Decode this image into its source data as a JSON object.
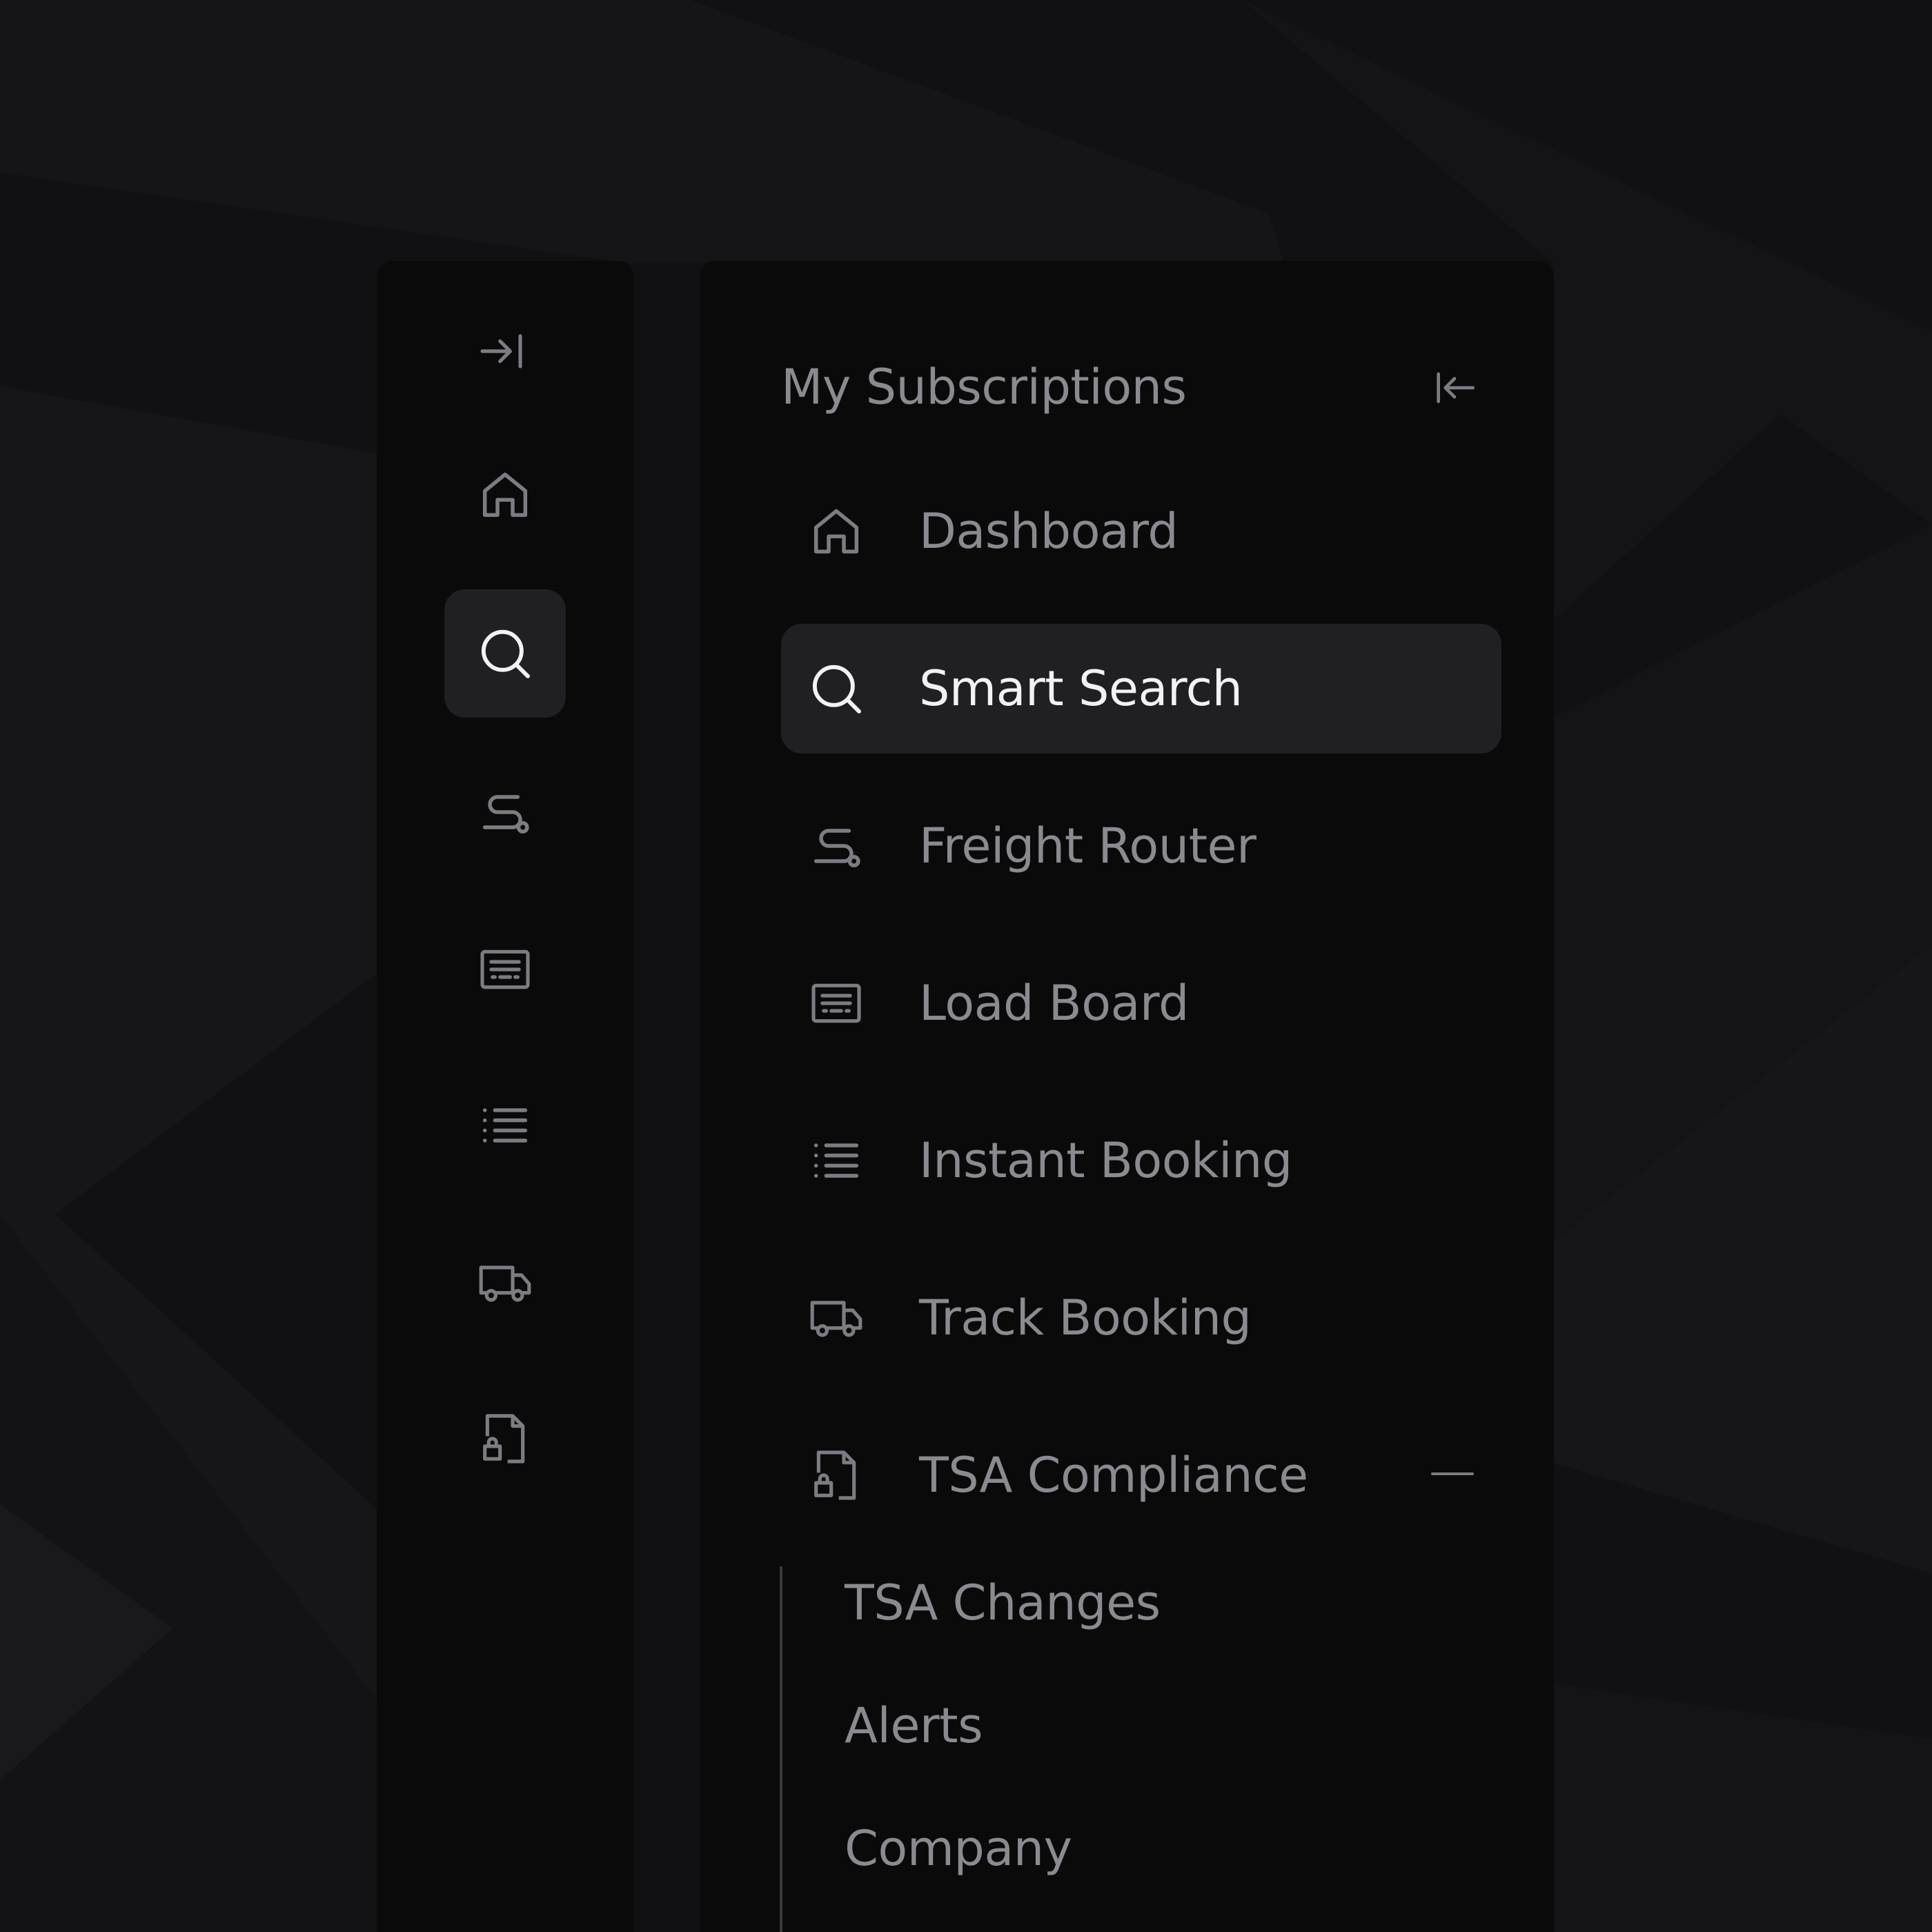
{
  "theme": {
    "background": "#111113",
    "panel": "#0a0a0b",
    "active_bg": "#202024",
    "text_muted": "#8a8a90",
    "text_active": "#f2f2f4",
    "icon_muted": "#7c7c82",
    "icon_active": "#f2f2f4"
  },
  "rail": {
    "expand_icon": "sidebar-expand-icon",
    "items": [
      {
        "icon": "home-icon",
        "active": false
      },
      {
        "icon": "search-icon",
        "active": true
      },
      {
        "icon": "route-icon",
        "active": false
      },
      {
        "icon": "load-board-icon",
        "active": false
      },
      {
        "icon": "list-icon",
        "active": false
      },
      {
        "icon": "truck-icon",
        "active": false
      },
      {
        "icon": "file-lock-icon",
        "active": false
      }
    ]
  },
  "panel": {
    "title": "My Subscriptions",
    "collapse_icon": "sidebar-collapse-icon",
    "items": [
      {
        "label": "Dashboard",
        "icon": "home-icon",
        "active": false
      },
      {
        "label": "Smart Search",
        "icon": "search-icon",
        "active": true
      },
      {
        "label": "Freight Router",
        "icon": "route-icon",
        "active": false
      },
      {
        "label": "Load Board",
        "icon": "load-board-icon",
        "active": false
      },
      {
        "label": "Instant Booking",
        "icon": "list-icon",
        "active": false
      },
      {
        "label": "Track Booking",
        "icon": "truck-icon",
        "active": false
      },
      {
        "label": "TSA Compliance",
        "icon": "file-lock-icon",
        "active": false,
        "expanded": true
      }
    ],
    "sub_items": [
      {
        "label": "TSA Changes"
      },
      {
        "label": "Alerts"
      },
      {
        "label": "Company"
      }
    ]
  }
}
